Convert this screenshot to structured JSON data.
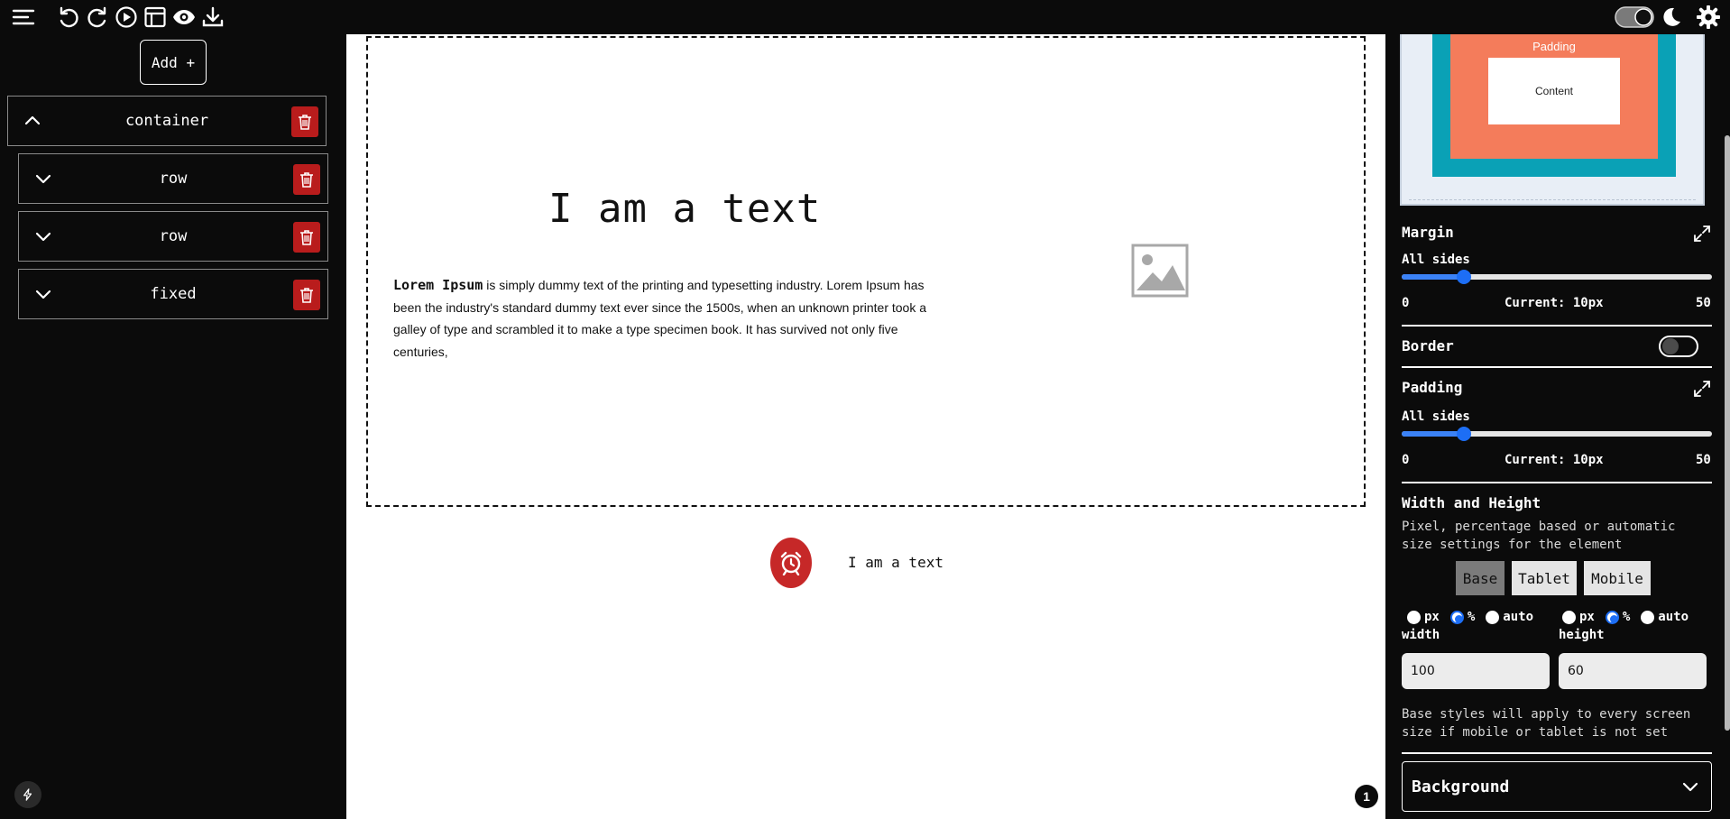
{
  "toolbar": {
    "icons": [
      "menu-icon",
      "undo-icon",
      "redo-icon",
      "play-icon",
      "layout-icon",
      "eye-icon",
      "download-icon",
      "toggle-icon",
      "moon-icon",
      "gear-icon"
    ]
  },
  "sidebar": {
    "add_label": "Add +",
    "items": [
      {
        "label": "container",
        "expanded": true
      },
      {
        "label": "row",
        "expanded": false
      },
      {
        "label": "row",
        "expanded": false
      },
      {
        "label": "fixed",
        "expanded": false
      }
    ]
  },
  "canvas": {
    "heading": "I am a text",
    "paragraph_bold": "Lorem Ipsum",
    "paragraph_rest": " is simply dummy text of the printing and typesetting industry. Lorem Ipsum has been the industry's standard dummy text ever since the 1500s, when an unknown printer took a galley of type and scrambled it to make a type specimen book. It has survived not only five centuries,",
    "small_text": "I am a text",
    "badge_count": "1"
  },
  "panel": {
    "boxmodel": {
      "padding_label": "Padding",
      "content_label": "Content"
    },
    "margin": {
      "title": "Margin",
      "sub": "All sides",
      "min": "0",
      "max": "50",
      "current": "Current: 10px",
      "value": 10
    },
    "border": {
      "title": "Border",
      "enabled": false
    },
    "padding": {
      "title": "Padding",
      "sub": "All sides",
      "min": "0",
      "max": "50",
      "current": "Current: 10px",
      "value": 10
    },
    "wh": {
      "title": "Width and Height",
      "desc": "Pixel, percentage based or automatic size settings for the element",
      "devices": [
        "Base",
        "Tablet",
        "Mobile"
      ],
      "selected_device": "Base",
      "unit_options": [
        "px",
        "%",
        "auto"
      ],
      "width_unit": "%",
      "height_unit": "%",
      "width_label": "width",
      "height_label": "height",
      "width_value": "100",
      "height_value": "60",
      "note": "Base styles will apply to every screen size if mobile or tablet is not set"
    },
    "background": {
      "title": "Background"
    }
  },
  "colors": {
    "accent": "#1d6ef5",
    "danger": "#b91c1c",
    "box_border": "#0aa1b6",
    "box_padding": "#f47c5b"
  }
}
